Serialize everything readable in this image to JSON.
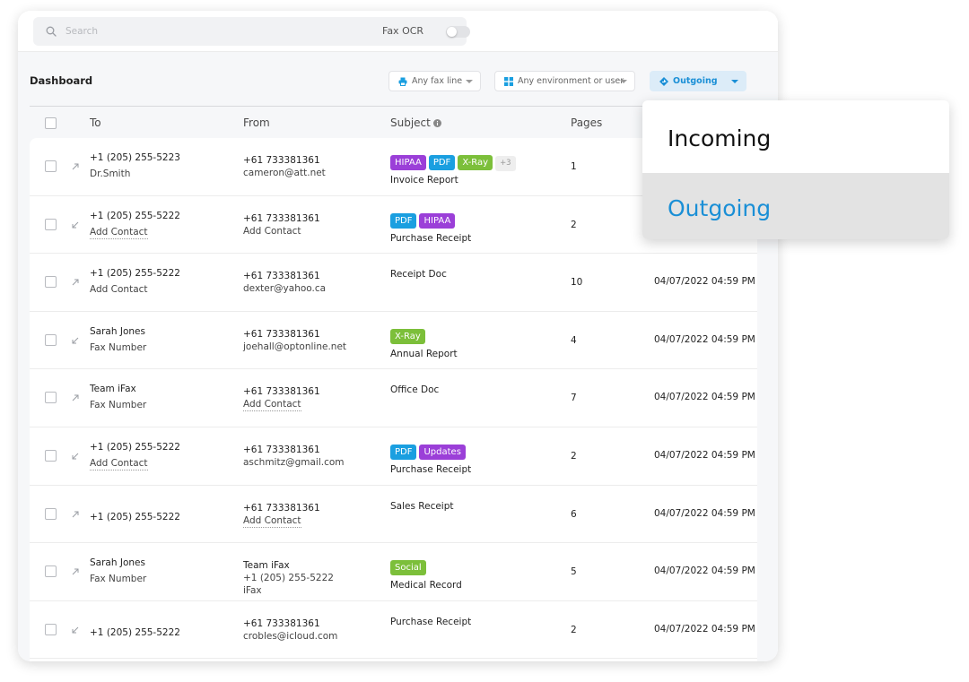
{
  "search": {
    "placeholder": "Search"
  },
  "fax_ocr": {
    "label": "Fax OCR",
    "enabled": false
  },
  "page_title": "Dashboard",
  "filters": {
    "fax_line": "Any fax line",
    "environment": "Any environment or user",
    "direction": "Outgoing"
  },
  "table": {
    "headers": {
      "to": "To",
      "from": "From",
      "subject": "Subject",
      "pages": "Pages"
    },
    "rows": [
      {
        "direction": "outgoing",
        "to": "+1 (205) 255-5223",
        "to_sub": "Dr.Smith",
        "to_sub_link": false,
        "from": "+61 733381361",
        "from_sub": "cameron@att.net",
        "from_sub_link": false,
        "from_sub2": "",
        "tags": [
          {
            "label": "HIPAA",
            "color": "#9b3fd8"
          },
          {
            "label": "PDF",
            "color": "#1a9fe0"
          },
          {
            "label": "X-Ray",
            "color": "#7cbf3a"
          }
        ],
        "tags_more": "+3",
        "subject": "Invoice Report",
        "pages": "1",
        "date": ""
      },
      {
        "direction": "incoming",
        "to": "+1 (205) 255-5222",
        "to_sub": "Add Contact",
        "to_sub_link": true,
        "from": "+61 733381361",
        "from_sub": "Add Contact",
        "from_sub_link": false,
        "from_sub2": "",
        "tags": [
          {
            "label": "PDF",
            "color": "#1a9fe0"
          },
          {
            "label": "HIPAA",
            "color": "#9b3fd8"
          }
        ],
        "tags_more": "",
        "subject": "Purchase Receipt",
        "pages": "2",
        "date": ""
      },
      {
        "direction": "outgoing",
        "to": "+1 (205) 255-5222",
        "to_sub": "Add Contact",
        "to_sub_link": false,
        "from": "+61 733381361",
        "from_sub": "dexter@yahoo.ca",
        "from_sub_link": false,
        "from_sub2": "",
        "tags": [],
        "tags_more": "",
        "subject": "Receipt Doc",
        "pages": "10",
        "date": "04/07/2022 04:59 PM"
      },
      {
        "direction": "incoming",
        "to": "Sarah Jones",
        "to_sub": "Fax Number",
        "to_sub_link": false,
        "from": "+61 733381361",
        "from_sub": "joehall@optonline.net",
        "from_sub_link": false,
        "from_sub2": "",
        "tags": [
          {
            "label": "X-Ray",
            "color": "#7cbf3a"
          }
        ],
        "tags_more": "",
        "subject": "Annual Report",
        "pages": "4",
        "date": "04/07/2022 04:59 PM"
      },
      {
        "direction": "outgoing",
        "to": "Team iFax",
        "to_sub": "Fax Number",
        "to_sub_link": false,
        "from": "+61 733381361",
        "from_sub": "Add Contact",
        "from_sub_link": true,
        "from_sub2": "",
        "tags": [],
        "tags_more": "",
        "subject": "Office Doc",
        "pages": "7",
        "date": "04/07/2022 04:59 PM"
      },
      {
        "direction": "incoming",
        "to": "+1 (205) 255-5222",
        "to_sub": "Add Contact",
        "to_sub_link": true,
        "from": "+61 733381361",
        "from_sub": "aschmitz@gmail.com",
        "from_sub_link": false,
        "from_sub2": "",
        "tags": [
          {
            "label": "PDF",
            "color": "#1a9fe0"
          },
          {
            "label": "Updates",
            "color": "#9b3fd8"
          }
        ],
        "tags_more": "",
        "subject": "Purchase Receipt",
        "pages": "2",
        "date": "04/07/2022 04:59 PM"
      },
      {
        "direction": "outgoing",
        "to": "+1 (205) 255-5222",
        "to_sub": "",
        "to_sub_link": false,
        "from": "+61 733381361",
        "from_sub": "Add Contact",
        "from_sub_link": true,
        "from_sub2": "",
        "tags": [],
        "tags_more": "",
        "subject": "Sales Receipt",
        "pages": "6",
        "date": "04/07/2022 04:59 PM"
      },
      {
        "direction": "outgoing",
        "to": "Sarah Jones",
        "to_sub": "Fax Number",
        "to_sub_link": false,
        "from": "Team iFax",
        "from_sub": "+1 (205) 255-5222",
        "from_sub_link": false,
        "from_sub2": "iFax",
        "tags": [
          {
            "label": "Social",
            "color": "#7cbf3a"
          }
        ],
        "tags_more": "",
        "subject": "Medical Record",
        "pages": "5",
        "date": "04/07/2022 04:59 PM"
      },
      {
        "direction": "incoming",
        "to": "+1 (205) 255-5222",
        "to_sub": "",
        "to_sub_link": false,
        "from": "+61 733381361",
        "from_sub": "crobles@icloud.com",
        "from_sub_link": false,
        "from_sub2": "",
        "tags": [],
        "tags_more": "",
        "subject": "Purchase Receipt",
        "pages": "2",
        "date": "04/07/2022 04:59 PM"
      }
    ]
  },
  "direction_menu": {
    "incoming": "Incoming",
    "outgoing": "Outgoing",
    "selected": "Outgoing"
  }
}
